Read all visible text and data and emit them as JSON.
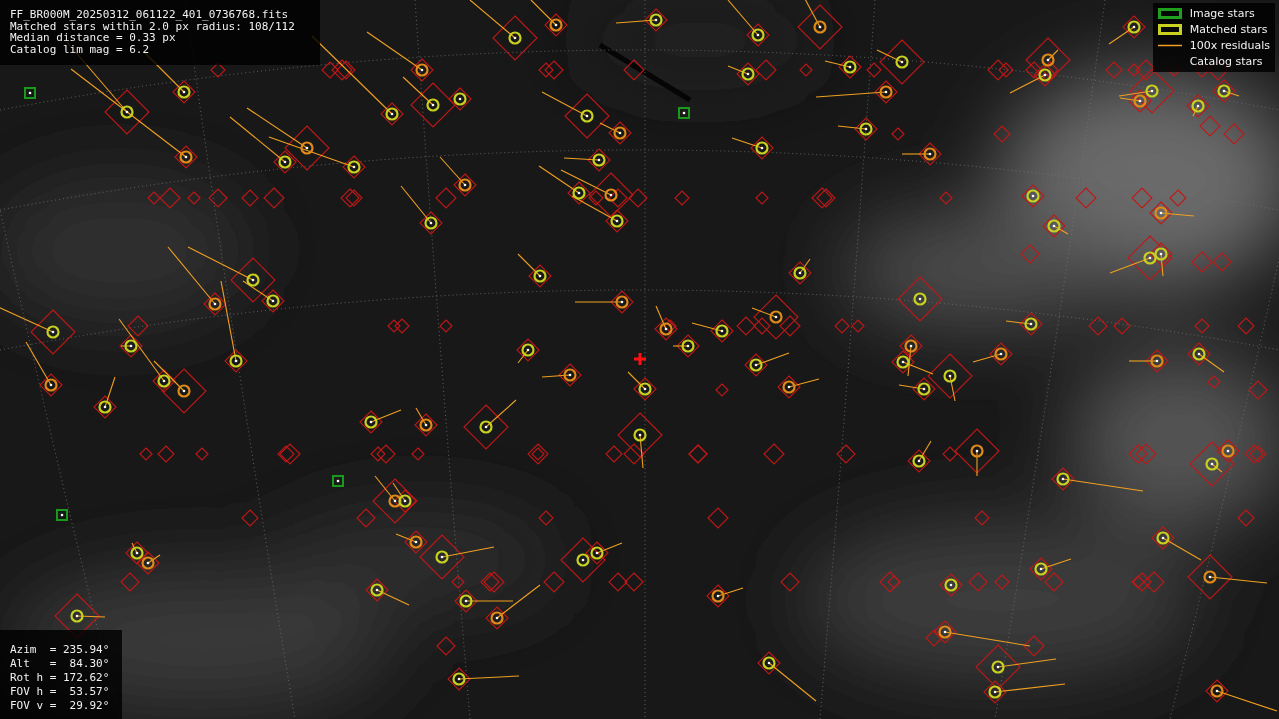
{
  "info_panel": {
    "lines": [
      "FF_BR000M_20250312_061122_401_0736768.fits",
      "Matched stars within 2.0 px radius: 108/112",
      "Median distance = 0.33 px",
      "Catalog lim mag = 6.2"
    ]
  },
  "legend": [
    {
      "label": "Image stars"
    },
    {
      "label": "Matched stars",
      "kind": "matched"
    },
    {
      "label": "100x residuals",
      "kind": "residual"
    },
    {
      "label": "Catalog stars",
      "kind": "catalog"
    }
  ],
  "pointing_panel": {
    "lines": [
      "Azim  = 235.94°",
      "Alt   =  84.30°",
      "Rot h = 172.62°",
      "FOV h =  53.57°",
      "FOV v =  29.92°"
    ]
  }
}
